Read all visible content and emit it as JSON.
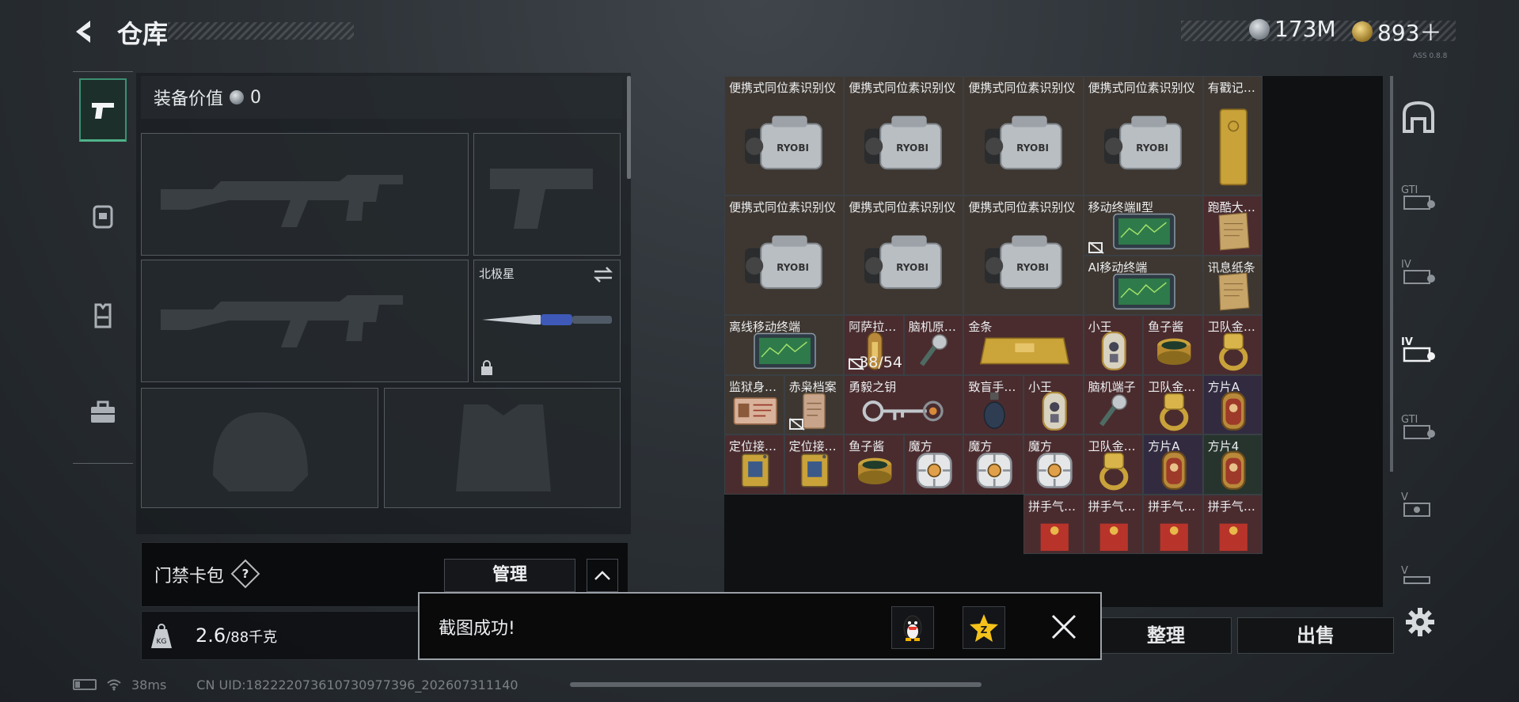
{
  "header": {
    "title": "仓库",
    "currency_silver": "173M",
    "currency_gold": "893＋",
    "small_text": "ASS 0.8.8"
  },
  "left_nav": {
    "items": [
      "pistol-icon",
      "backpack-icon",
      "vest-icon",
      "briefcase-icon"
    ]
  },
  "equipment": {
    "value_label": "装备价值",
    "value_amount": "0",
    "melee_slot_label": "北极星"
  },
  "keycard": {
    "label": "门禁卡包",
    "help": "?",
    "manage": "管理"
  },
  "weight": {
    "current": "2.6",
    "max": "/88千克",
    "icon_label": "KG"
  },
  "status": {
    "ping": "38ms",
    "uid": "CN UID:18222207361073097739​6_202607311140"
  },
  "storage": {
    "items": [
      {
        "name": "便携式同位素识别仪",
        "color": "brown",
        "icon": "ryobi-scanner"
      },
      {
        "name": "便携式同位素识别仪",
        "color": "brown",
        "icon": "ryobi-scanner"
      },
      {
        "name": "便携式同位素识别仪",
        "color": "brown",
        "icon": "ryobi-scanner"
      },
      {
        "name": "便携式同位素识别仪",
        "color": "brown",
        "icon": "ryobi-scanner"
      },
      {
        "name": "有戳记的…",
        "color": "brown",
        "icon": "gold-bar-vertical"
      },
      {
        "name": "便携式同位素识别仪",
        "color": "brown",
        "icon": "ryobi-scanner"
      },
      {
        "name": "便携式同位素识别仪",
        "color": "brown",
        "icon": "ryobi-scanner"
      },
      {
        "name": "便携式同位素识别仪",
        "color": "brown",
        "icon": "ryobi-scanner"
      },
      {
        "name": "移动终端Ⅱ型",
        "color": "brown",
        "icon": "terminal"
      },
      {
        "name": "跑酷大师…",
        "color": "red",
        "icon": "paper"
      },
      {
        "name": "AI移动终端",
        "color": "brown",
        "icon": "terminal"
      },
      {
        "name": "讯息纸条",
        "color": "brown",
        "icon": "paper"
      },
      {
        "name": "离线移动终端",
        "color": "brown",
        "icon": "terminal"
      },
      {
        "name": "阿萨拉牌…",
        "color": "red",
        "icon": "brass-token"
      },
      {
        "name": "脑机原型机",
        "color": "red",
        "icon": "bci-device"
      },
      {
        "name": "金条",
        "color": "red",
        "icon": "gold-bar"
      },
      {
        "name": "小王",
        "color": "red",
        "icon": "card-king"
      },
      {
        "name": "鱼子酱",
        "color": "red",
        "icon": "caviar"
      },
      {
        "name": "卫队金扳指",
        "color": "red",
        "icon": "gold-ring"
      },
      {
        "name": "监狱身份证",
        "color": "brown",
        "icon": "id-card"
      },
      {
        "name": "赤枭档案",
        "color": "brown",
        "icon": "archive"
      },
      {
        "name": "勇毅之钥",
        "color": "red",
        "icon": "key"
      },
      {
        "name": "致盲手雷…",
        "color": "red",
        "icon": "grenade"
      },
      {
        "name": "小王",
        "color": "red",
        "icon": "card-king"
      },
      {
        "name": "脑机端子",
        "color": "red",
        "icon": "bci-device"
      },
      {
        "name": "卫队金扳指",
        "color": "red",
        "icon": "gold-ring"
      },
      {
        "name": "方片A",
        "color": "purple",
        "icon": "card-ace"
      },
      {
        "name": "定位接收器",
        "color": "red",
        "icon": "receiver"
      },
      {
        "name": "定位接收器",
        "color": "red",
        "icon": "receiver"
      },
      {
        "name": "鱼子酱",
        "color": "red",
        "icon": "caviar"
      },
      {
        "name": "魔方",
        "color": "red",
        "icon": "cube"
      },
      {
        "name": "魔方",
        "color": "red",
        "icon": "cube"
      },
      {
        "name": "魔方",
        "color": "red",
        "icon": "cube"
      },
      {
        "name": "卫队金扳指",
        "color": "red",
        "icon": "gold-ring"
      },
      {
        "name": "方片A",
        "color": "purple",
        "icon": "card-ace"
      },
      {
        "name": "方片4",
        "color": "green",
        "icon": "card-ace"
      },
      {
        "name": "拼手气红包",
        "color": "red",
        "icon": "red-packet"
      },
      {
        "name": "拼手气红包",
        "color": "red",
        "icon": "red-packet"
      },
      {
        "name": "拼手气红包",
        "color": "red",
        "icon": "red-packet"
      },
      {
        "name": "拼手气红包",
        "color": "red",
        "icon": "red-packet"
      }
    ],
    "stack_count": "38/54"
  },
  "right_nav": {
    "items": [
      "safe-house-icon",
      "gti-tab-1",
      "iv-tab-1",
      "iv-tab-2",
      "gti-tab-2",
      "v-tab-1",
      "v-tab-2"
    ]
  },
  "actions": {
    "sort": "整理",
    "sell": "出售"
  },
  "toast": {
    "message": "截图成功!"
  },
  "colors": {
    "brown": "#3e3731",
    "red": "#4a2c2f",
    "purple": "#322b40",
    "green": "#26342d",
    "accent": "#4fb38a"
  }
}
